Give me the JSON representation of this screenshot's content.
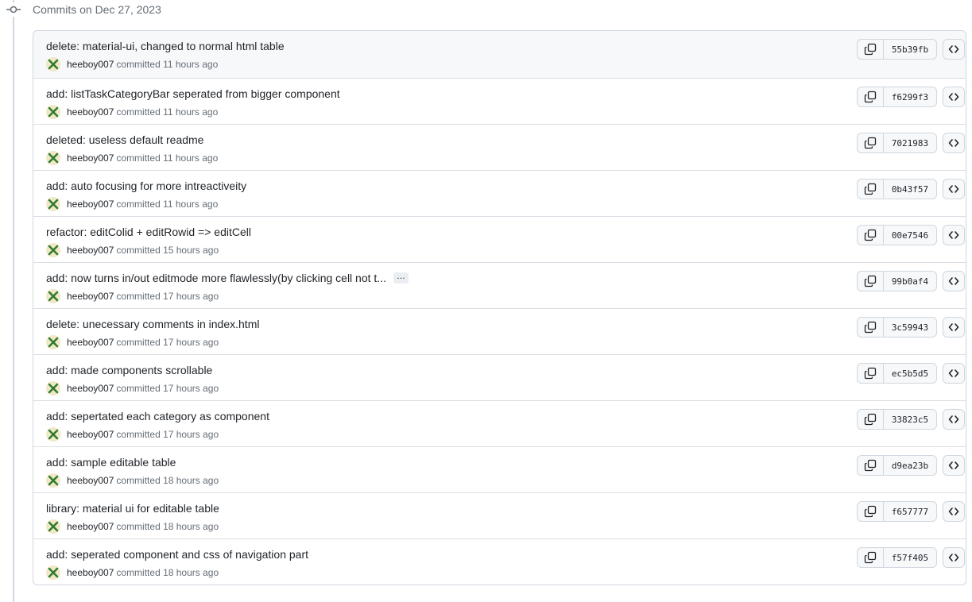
{
  "group": {
    "title": "Commits on Dec 27, 2023"
  },
  "colors": {
    "border": "#d0d7de",
    "muted_text": "#656d76",
    "text": "#1f2328",
    "avatar_bg": "#f2e8c6",
    "avatar_mark": "#2f7d32"
  },
  "icons": {
    "timeline": "git-commit-icon",
    "copy": "copy-icon",
    "browse": "code-icon",
    "avatar": "identicon-avatar"
  },
  "commits": [
    {
      "message": "delete: material-ui, changed to normal html table",
      "author": "heeboy007",
      "committed": "committed 11 hours ago",
      "sha": "55b39fb",
      "truncated": false
    },
    {
      "message": "add: listTaskCategoryBar seperated from bigger component",
      "author": "heeboy007",
      "committed": "committed 11 hours ago",
      "sha": "f6299f3",
      "truncated": false
    },
    {
      "message": "deleted: useless default readme",
      "author": "heeboy007",
      "committed": "committed 11 hours ago",
      "sha": "7021983",
      "truncated": false
    },
    {
      "message": "add: auto focusing for more intreactiveity",
      "author": "heeboy007",
      "committed": "committed 11 hours ago",
      "sha": "0b43f57",
      "truncated": false
    },
    {
      "message": "refactor: editColid + editRowid => editCell",
      "author": "heeboy007",
      "committed": "committed 15 hours ago",
      "sha": "00e7546",
      "truncated": false
    },
    {
      "message": "add: now turns in/out editmode more flawlessly(by clicking cell not t...",
      "author": "heeboy007",
      "committed": "committed 17 hours ago",
      "sha": "99b0af4",
      "truncated": true,
      "ellipsis_label": "…"
    },
    {
      "message": "delete: unecessary comments in index.html",
      "author": "heeboy007",
      "committed": "committed 17 hours ago",
      "sha": "3c59943",
      "truncated": false
    },
    {
      "message": "add: made components scrollable",
      "author": "heeboy007",
      "committed": "committed 17 hours ago",
      "sha": "ec5b5d5",
      "truncated": false
    },
    {
      "message": "add: sepertated each category as component",
      "author": "heeboy007",
      "committed": "committed 17 hours ago",
      "sha": "33823c5",
      "truncated": false
    },
    {
      "message": "add: sample editable table",
      "author": "heeboy007",
      "committed": "committed 18 hours ago",
      "sha": "d9ea23b",
      "truncated": false
    },
    {
      "message": "library: material ui for editable table",
      "author": "heeboy007",
      "committed": "committed 18 hours ago",
      "sha": "f657777",
      "truncated": false
    },
    {
      "message": "add: seperated component and css of navigation part",
      "author": "heeboy007",
      "committed": "committed 18 hours ago",
      "sha": "f57f405",
      "truncated": false
    }
  ]
}
